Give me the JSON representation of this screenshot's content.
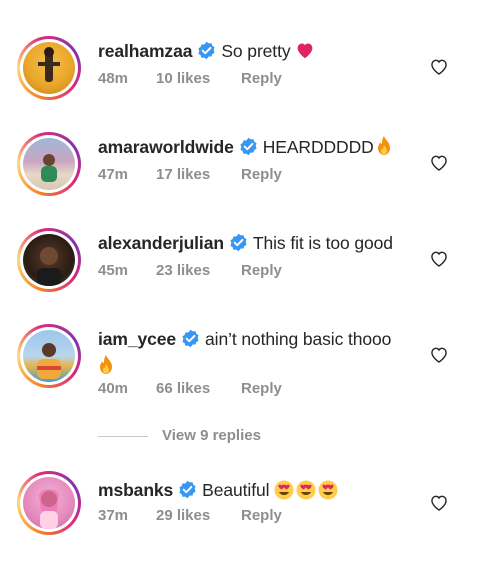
{
  "comments": [
    {
      "username": "realhamzaa",
      "text": "So pretty",
      "emoji": "❤️",
      "time": "48m",
      "likes": "10 likes",
      "reply": "Reply"
    },
    {
      "username": "amaraworldwide",
      "text": "HEARDDDDD",
      "emoji": "🔥",
      "time": "47m",
      "likes": "17 likes",
      "reply": "Reply"
    },
    {
      "username": "alexanderjulian",
      "text": "This fit is too good",
      "emoji": "",
      "time": "45m",
      "likes": "23 likes",
      "reply": "Reply"
    },
    {
      "username": "iam_ycee",
      "text": "ain’t nothing basic thooo",
      "emoji": "🔥",
      "time": "40m",
      "likes": "66 likes",
      "reply": "Reply"
    },
    {
      "username": "msbanks",
      "text": "Beautiful",
      "emoji": "😍😍😍",
      "time": "37m",
      "likes": "29 likes",
      "reply": "Reply"
    }
  ],
  "view_replies": "View 9 replies",
  "colors": {
    "verified": "#3897f0",
    "meta": "#8e8e8e",
    "text": "#262626"
  }
}
